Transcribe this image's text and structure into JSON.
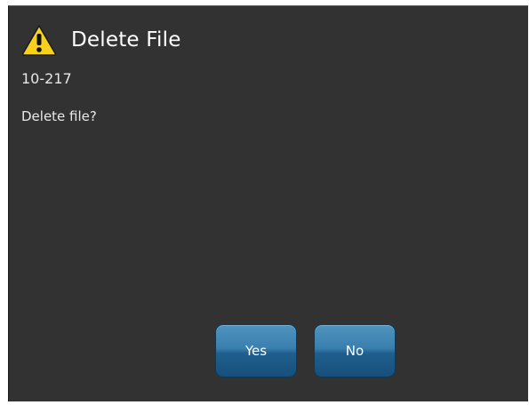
{
  "dialog": {
    "title": "Delete File",
    "file_name": "10-217",
    "message": "Delete file?",
    "icon": "warning-icon"
  },
  "buttons": {
    "yes_label": "Yes",
    "no_label": "No"
  },
  "colors": {
    "background": "#323232",
    "button_blue": "#2c6e9e",
    "warning_yellow": "#f7d11a"
  }
}
